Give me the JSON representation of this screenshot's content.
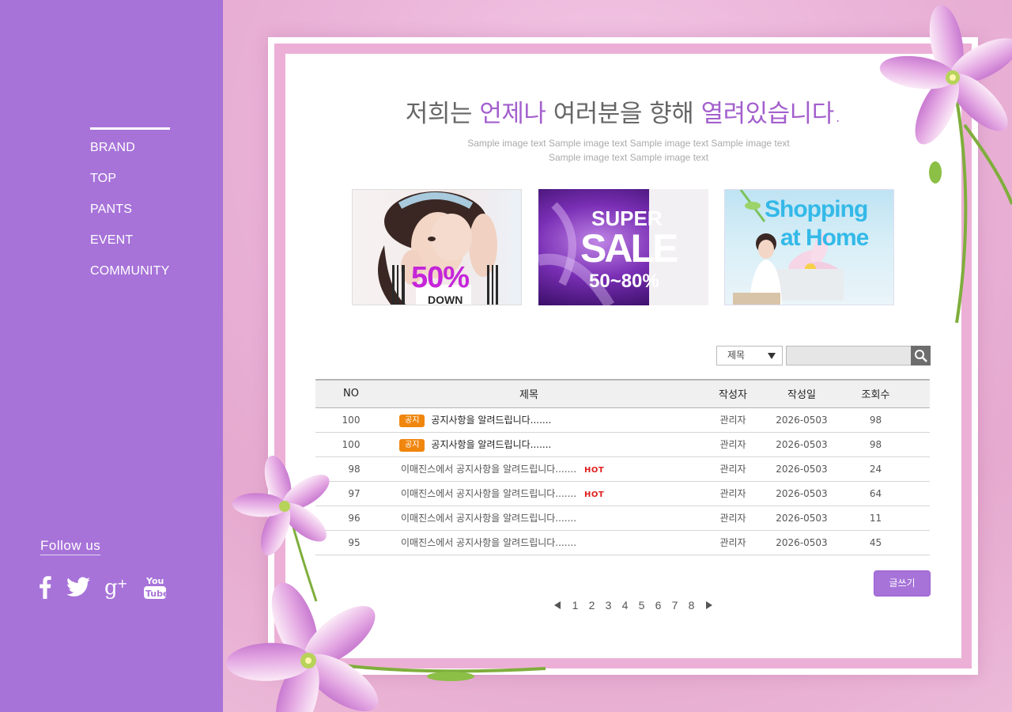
{
  "sidebar": {
    "nav": [
      "BRAND",
      "TOP",
      "PANTS",
      "EVENT",
      "COMMUNITY"
    ],
    "follow_label": "Follow us",
    "social_icons": [
      "facebook-icon",
      "twitter-icon",
      "google-plus-icon",
      "youtube-icon"
    ],
    "youtube_text": [
      "You",
      "Tube"
    ]
  },
  "hero": {
    "headline_part1": "저희는 ",
    "headline_hl1": "언제나",
    "headline_part2": " 여러분을 향해 ",
    "headline_hl2": "열려있습니다.",
    "subtext_line1": "Sample image text Sample image text Sample image text Sample image text",
    "subtext_line2": "Sample image text Sample image text"
  },
  "banners": {
    "b1": {
      "big": "50%",
      "small": "DOWN"
    },
    "b2": {
      "line1": "SUPER",
      "line2": "SALE",
      "line3": "50~80%"
    },
    "b3": {
      "line1": "Shopping",
      "line2": "at Home"
    }
  },
  "search": {
    "select_value": "제목",
    "query": ""
  },
  "table": {
    "headers": {
      "no": "NO",
      "title": "제목",
      "writer": "작성자",
      "date": "작성일",
      "views": "조회수"
    },
    "rows": [
      {
        "no": "100",
        "badge": "공지",
        "title": "공지사항을 알려드립니다.......",
        "hot": "",
        "writer": "관리자",
        "date": "2026-0503",
        "views": "98"
      },
      {
        "no": "100",
        "badge": "공지",
        "title": "공지사항을 알려드립니다.......",
        "hot": "",
        "writer": "관리자",
        "date": "2026-0503",
        "views": "98"
      },
      {
        "no": "98",
        "badge": "",
        "title": "이매진스에서 공지사항을 알려드립니다.......",
        "hot": "HOT",
        "writer": "관리자",
        "date": "2026-0503",
        "views": "24"
      },
      {
        "no": "97",
        "badge": "",
        "title": "이매진스에서 공지사항을 알려드립니다.......",
        "hot": "HOT",
        "writer": "관리자",
        "date": "2026-0503",
        "views": "64"
      },
      {
        "no": "96",
        "badge": "",
        "title": "이매진스에서 공지사항을 알려드립니다.......",
        "hot": "",
        "writer": "관리자",
        "date": "2026-0503",
        "views": "11"
      },
      {
        "no": "95",
        "badge": "",
        "title": "이매진스에서 공지사항을 알려드립니다.......",
        "hot": "",
        "writer": "관리자",
        "date": "2026-0503",
        "views": "45"
      }
    ]
  },
  "write_label": "글쓰기",
  "pager": {
    "pages": [
      "1",
      "2",
      "3",
      "4",
      "5",
      "6",
      "7",
      "8"
    ]
  },
  "colors": {
    "accent": "#a773d9",
    "headline_highlight": "#a35fcd",
    "badge": "#f0860e",
    "hot": "#e02020"
  }
}
